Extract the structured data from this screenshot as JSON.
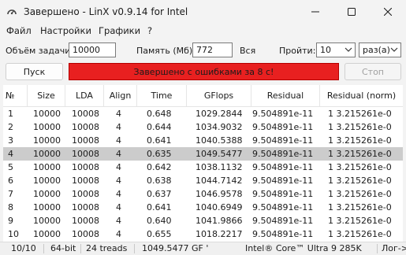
{
  "window": {
    "title": "Завершено - LinX v0.9.14 for Intel",
    "minimize_glyph": "—",
    "maximize_glyph": "☐",
    "close_glyph": "✕"
  },
  "menu": {
    "items": [
      "Файл",
      "Настройки",
      "Графики",
      "?"
    ]
  },
  "params": {
    "task_size_label": "Объём задачи:",
    "task_size_value": "10000",
    "memory_label": "Память (Мб):",
    "memory_value": "772",
    "memory_all_label": "Вся",
    "runs_label": "Пройти:",
    "runs_value": "10",
    "runs_unit_value": "раз(а)"
  },
  "controls": {
    "start_label": "Пуск",
    "status_message": "Завершено с ошибками за 8 с!",
    "status_color": "#e82020",
    "stop_label": "Стоп"
  },
  "table": {
    "columns": [
      "№",
      "Size",
      "LDA",
      "Align",
      "Time",
      "GFlops",
      "Residual",
      "Residual (norm)"
    ],
    "rows": [
      [
        "1",
        "10000",
        "10008",
        "4",
        "0.648",
        "1029.2844",
        "9.504891e-11",
        "1 3.215261e-0"
      ],
      [
        "2",
        "10000",
        "10008",
        "4",
        "0.644",
        "1034.9032",
        "9.504891e-11",
        "1 3.215261e-0"
      ],
      [
        "3",
        "10000",
        "10008",
        "4",
        "0.641",
        "1040.5388",
        "9.504891e-11",
        "1 3.215261e-0"
      ],
      [
        "4",
        "10000",
        "10008",
        "4",
        "0.635",
        "1049.5477",
        "9.504891e-11",
        "1 3.215261e-0"
      ],
      [
        "5",
        "10000",
        "10008",
        "4",
        "0.642",
        "1038.1132",
        "9.504891e-11",
        "1 3.215261e-0"
      ],
      [
        "6",
        "10000",
        "10008",
        "4",
        "0.638",
        "1044.7142",
        "9.504891e-11",
        "1 3.215261e-0"
      ],
      [
        "7",
        "10000",
        "10008",
        "4",
        "0.637",
        "1046.9578",
        "9.504891e-11",
        "1 3.215261e-0"
      ],
      [
        "8",
        "10000",
        "10008",
        "4",
        "0.641",
        "1040.6949",
        "9.504891e-11",
        "1 3.215261e-0"
      ],
      [
        "9",
        "10000",
        "10008",
        "4",
        "0.640",
        "1041.9866",
        "9.504891e-11",
        "1 3.215261e-0"
      ],
      [
        "10",
        "10000",
        "10008",
        "4",
        "0.655",
        "1018.2217",
        "9.504891e-11",
        "1 3.215261e-0"
      ]
    ],
    "selected_row": 4
  },
  "statusbar": {
    "progress": "10/10",
    "arch": "64-bit",
    "threads": "24 treads",
    "peak": "1049.5477 GF '",
    "cpu": "Intel® Core™ Ultra 9 285K",
    "log": "Лог->"
  }
}
